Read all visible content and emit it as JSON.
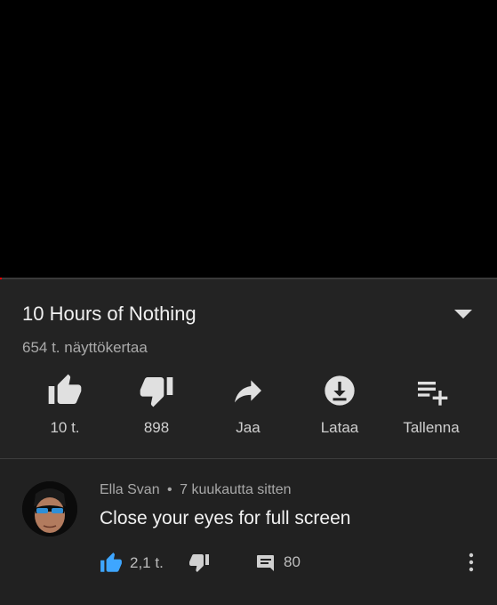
{
  "player": {
    "progress_fraction": 0.002
  },
  "video": {
    "title": "10 Hours of Nothing",
    "views": "654 t. näyttökertaa"
  },
  "actions": {
    "like": {
      "label": "10 t.",
      "icon": "thumb-up-icon"
    },
    "dislike": {
      "label": "898",
      "icon": "thumb-down-icon"
    },
    "share": {
      "label": "Jaa",
      "icon": "share-icon"
    },
    "download": {
      "label": "Lataa",
      "icon": "download-icon"
    },
    "save": {
      "label": "Tallenna",
      "icon": "playlist-add-icon"
    }
  },
  "comment": {
    "author": "Ella Svan",
    "separator": "•",
    "time": "7 kuukautta sitten",
    "text": "Close your eyes for full screen",
    "likes": "2,1 t.",
    "replies": "80"
  },
  "colors": {
    "accent_blue": "#3ea6ff",
    "progress_red": "#ff0000",
    "background": "#212121",
    "player_background": "#000000"
  }
}
